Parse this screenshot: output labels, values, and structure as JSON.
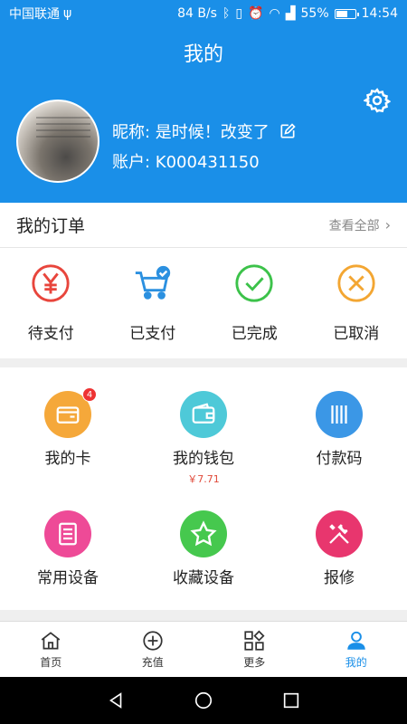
{
  "status_bar": {
    "carrier": "中国联通",
    "usb_icon": "usb-icon",
    "speed": "84 B/s",
    "battery": "55%",
    "time": "14:54"
  },
  "header": {
    "title": "我的",
    "nickname_label": "昵称: 是时候！改变了",
    "account_label": "账户: K000431150",
    "settings_icon": "gear-icon",
    "edit_icon": "edit-icon",
    "avatar_text": "如果你现在不努力 将来靠什么 拐到现在看不起你的人"
  },
  "orders": {
    "title": "我的订单",
    "view_all": "查看全部",
    "items": [
      {
        "label": "待支付",
        "icon": "yen-icon",
        "color": "#e8453c"
      },
      {
        "label": "已支付",
        "icon": "cart-check-icon",
        "color": "#2b90e0"
      },
      {
        "label": "已完成",
        "icon": "check-circle-icon",
        "color": "#3cc24a"
      },
      {
        "label": "已取消",
        "icon": "x-circle-icon",
        "color": "#f3a632"
      }
    ]
  },
  "services": {
    "items": [
      {
        "label": "我的卡",
        "icon": "card-icon",
        "color": "#f5a83a",
        "badge": "4"
      },
      {
        "label": "我的钱包",
        "icon": "wallet-icon",
        "color": "#4ec9d8",
        "sub": "￥7.71"
      },
      {
        "label": "付款码",
        "icon": "barcode-icon",
        "color": "#3b97e6"
      },
      {
        "label": "常用设备",
        "icon": "list-icon",
        "color": "#ee4a97"
      },
      {
        "label": "收藏设备",
        "icon": "star-icon",
        "color": "#46c84e"
      },
      {
        "label": "报修",
        "icon": "tools-icon",
        "color": "#e8366e"
      }
    ]
  },
  "tabbar": {
    "items": [
      {
        "label": "首页",
        "icon": "home-icon"
      },
      {
        "label": "充值",
        "icon": "plus-circle-icon"
      },
      {
        "label": "更多",
        "icon": "grid-icon"
      },
      {
        "label": "我的",
        "icon": "user-icon",
        "active": true
      }
    ]
  },
  "accent_color": "#1a8fe8"
}
